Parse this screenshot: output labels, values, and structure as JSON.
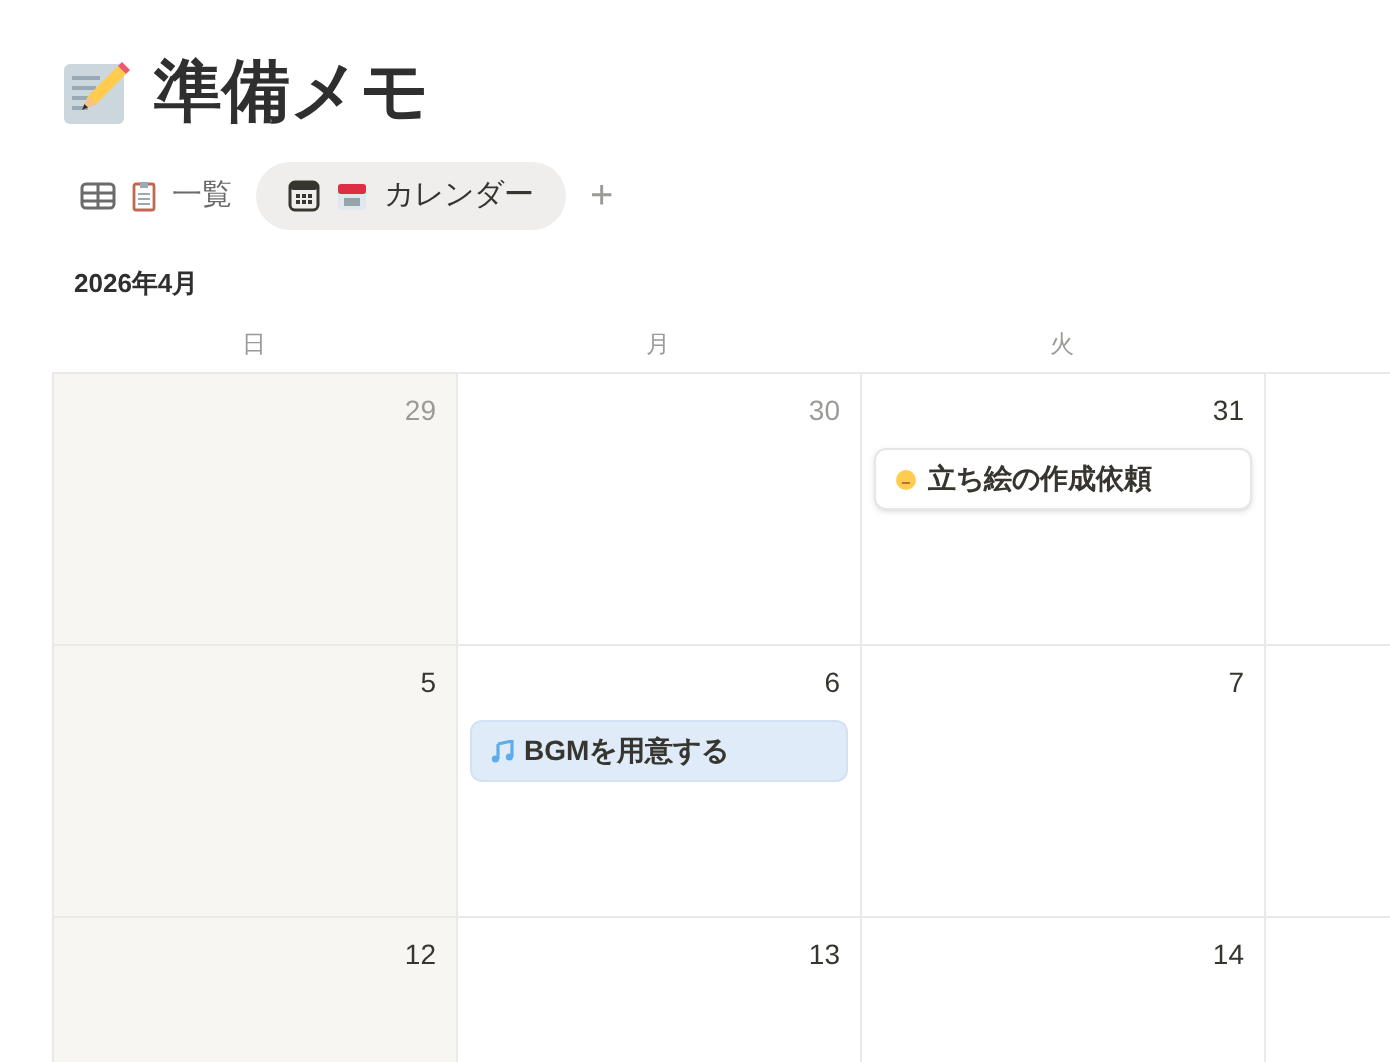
{
  "page": {
    "title": "準備メモ"
  },
  "views": [
    {
      "kind": "table",
      "label": "一覧",
      "selected": false
    },
    {
      "kind": "calendar",
      "label": "カレンダー",
      "selected": true
    }
  ],
  "add_view": "+",
  "calendar": {
    "month": "2026年4月",
    "weekdays": [
      "日",
      "月",
      "火"
    ],
    "weeks": [
      [
        {
          "date": "29",
          "other_month": true
        },
        {
          "date": "30",
          "other_month": true
        },
        {
          "date": "31",
          "other_month": false,
          "events": [
            {
              "kind": "face",
              "title": "立ち絵の作成依頼",
              "selected": false
            }
          ]
        }
      ],
      [
        {
          "date": "5",
          "other_month": false
        },
        {
          "date": "6",
          "other_month": false,
          "events": [
            {
              "kind": "music",
              "title": "BGMを用意する",
              "selected": true
            }
          ]
        },
        {
          "date": "7",
          "other_month": false
        }
      ],
      [
        {
          "date": "12",
          "other_month": false
        },
        {
          "date": "13",
          "other_month": false
        },
        {
          "date": "14",
          "other_month": false
        }
      ]
    ]
  }
}
